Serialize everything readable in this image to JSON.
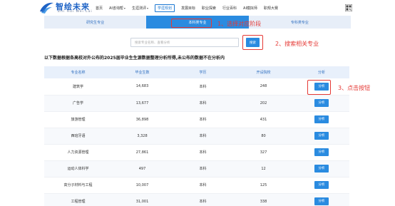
{
  "logo": {
    "title": "智绘未来",
    "subtitle": "Zhi Hui Wei Lai"
  },
  "nav": [
    {
      "label": "首页",
      "caret": false,
      "active": false
    },
    {
      "label": "AI咨询帮",
      "caret": true,
      "active": false
    },
    {
      "label": "生涯测评",
      "caret": true,
      "active": false
    },
    {
      "label": "学涯规划",
      "caret": false,
      "active": true
    },
    {
      "label": "发展目标",
      "caret": false,
      "active": false
    },
    {
      "label": "职业探索",
      "caret": false,
      "active": false
    },
    {
      "label": "行业百科",
      "caret": false,
      "active": false
    },
    {
      "label": "AI模拟师",
      "caret": false,
      "active": false
    },
    {
      "label": "职规大赛",
      "caret": false,
      "active": false
    }
  ],
  "tabs": [
    {
      "label": "研究生专业",
      "active": false
    },
    {
      "label": "本科类专业",
      "active": true
    },
    {
      "label": "专科类专业",
      "active": false
    }
  ],
  "search": {
    "placeholder": "搜索专业名称、查看分析",
    "button": "搜索"
  },
  "annotations": {
    "step1": "1、选择对应阶段",
    "step2": "2、搜索相关专业",
    "step3": "3、点击按钮"
  },
  "description": "以下数据根据各高校对外公布的2025届毕业生生源数据整理分析所得,未公布的数据不在分析内",
  "table": {
    "columns": [
      "专业名称",
      "毕业生数",
      "学历",
      "开设院校",
      "分析"
    ],
    "rows": [
      {
        "name": "建筑学",
        "grads": "14,683",
        "degree": "本科",
        "schools": "248",
        "action": "分析"
      },
      {
        "name": "广告学",
        "grads": "13,677",
        "degree": "本科",
        "schools": "202",
        "action": "分析"
      },
      {
        "name": "旅游管理",
        "grads": "36,898",
        "degree": "本科",
        "schools": "431",
        "action": "分析"
      },
      {
        "name": "西班牙语",
        "grads": "3,328",
        "degree": "本科",
        "schools": "80",
        "action": "分析"
      },
      {
        "name": "人力资源管理",
        "grads": "27,861",
        "degree": "本科",
        "schools": "327",
        "action": "分析"
      },
      {
        "name": "运动人体科学",
        "grads": "497",
        "degree": "本科",
        "schools": "12",
        "action": "分析"
      },
      {
        "name": "高分子材料与工程",
        "grads": "10,007",
        "degree": "本科",
        "schools": "125",
        "action": "分析"
      },
      {
        "name": "工程管理",
        "grads": "31,001",
        "degree": "本科",
        "schools": "338",
        "action": "分析"
      }
    ]
  },
  "colors": {
    "primary": "#2a8be0",
    "annotation": "#e53935",
    "header_bg": "#e8f0fb"
  },
  "icons": {
    "logo": "wing-logo-icon",
    "qr": "qr-code-icon"
  }
}
